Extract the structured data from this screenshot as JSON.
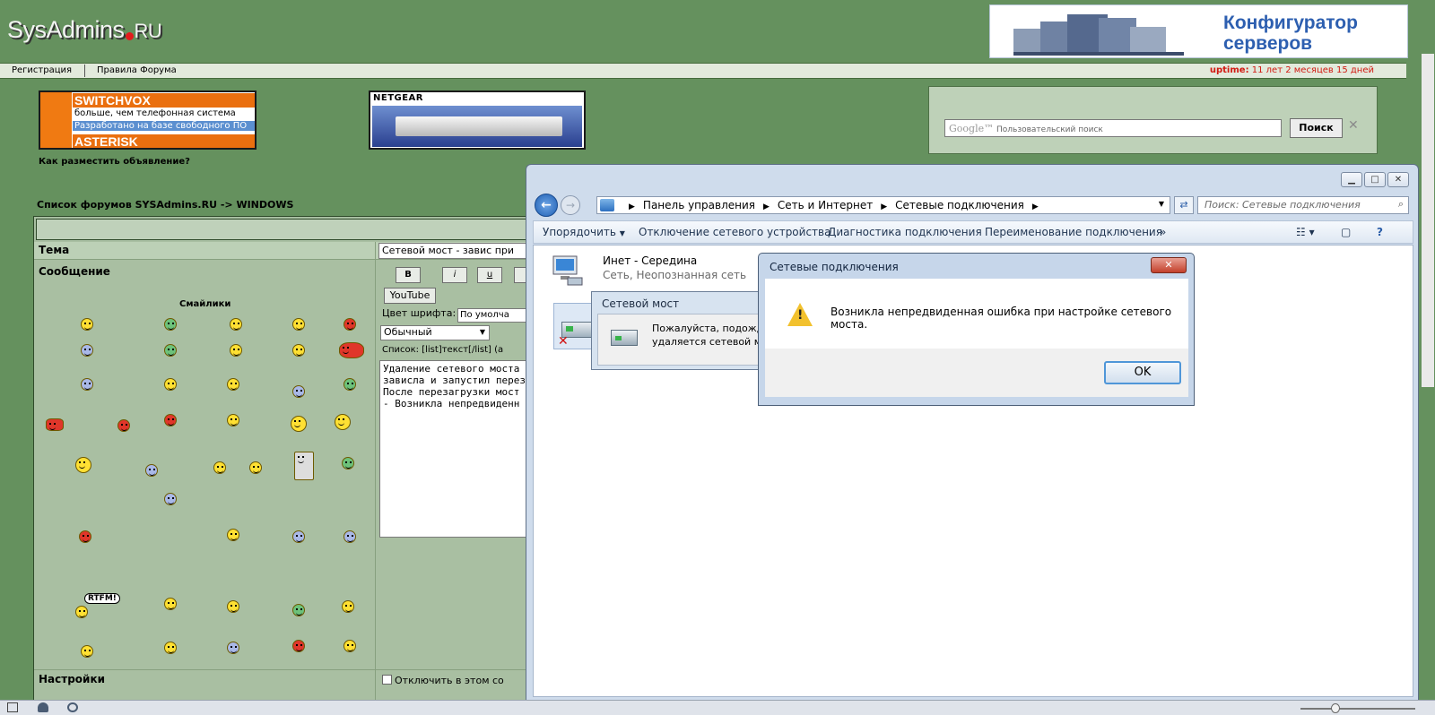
{
  "site": {
    "logo_main": "SysAdmins",
    "logo_tld": "RU",
    "top_ad_title": "Конфигуратор серверов",
    "nav": [
      "Регистрация",
      "Правила Форума"
    ],
    "uptime_label": "uptime:",
    "uptime_value": "11 лет 2 месяцев 15 дней",
    "ad1": {
      "line1": "SWITCHVOX",
      "line2": "больше, чем телефонная система",
      "line3": "Разработано на базе свободного ПО",
      "line4": "ASTERISK"
    },
    "ad2_brand": "NETGEAR",
    "howto": "Как разместить объявление?",
    "search": {
      "placeholder_logo": "Google™",
      "placeholder": "Пользовательский поиск",
      "button": "Поиск",
      "clear": "✕"
    },
    "breadcrumb": "Список форумов SYSAdmins.RU -> WINDOWS"
  },
  "forum_form": {
    "topic_label": "Тема",
    "topic_value": "Сетевой мост - завис при",
    "message_label": "Сообщение",
    "smiles_title": "Смайлики",
    "rtfm": "RTFM!",
    "buttons": {
      "bold": "B",
      "italic": "i",
      "underline": "u",
      "youtube": "YouTube"
    },
    "font_color_label": "Цвет шрифта:",
    "font_color_value": "По умолча",
    "size_value": "Обычный",
    "list_hint": "Список: [list]текст[/list] (a",
    "message_text": "Удаление сетевого моста\nзависла и запустил перез\nПосле перезагрузки мост\n- Возникла непредвиденн",
    "settings_label": "Настройки",
    "settings_option": "Отключить в этом со"
  },
  "explorer": {
    "address": [
      "Панель управления",
      "Сеть и Интернет",
      "Сетевые подключения"
    ],
    "search_placeholder": "Поиск: Сетевые подключения",
    "commands": [
      "Упорядочить",
      "Отключение сетевого устройства",
      "Диагностика подключения",
      "Переименование подключения"
    ],
    "more": "»",
    "connection_name": "Инет - Середина",
    "connection_status": "Сеть, Неопознанная сеть"
  },
  "progress_dialog": {
    "title": "Сетевой мост",
    "line1": "Пожалуйста, подождите",
    "line2": "удаляется сетевой мос"
  },
  "error_dialog": {
    "title": "Сетевые подключения",
    "message": "Возникла непредвиденная ошибка при настройке сетевого моста.",
    "ok": "OK",
    "close": "✕"
  },
  "icons": [
    "logo-dot-icon",
    "server-rack-icon",
    "warning-icon",
    "network-bridge-icon",
    "network-connection-icon",
    "back-arrow-icon",
    "forward-arrow-icon",
    "refresh-icon",
    "search-icon",
    "help-icon"
  ],
  "colors": {
    "forum_bg": "#65915e",
    "uptime": "#d21a12",
    "accent": "#2d5fb0"
  }
}
